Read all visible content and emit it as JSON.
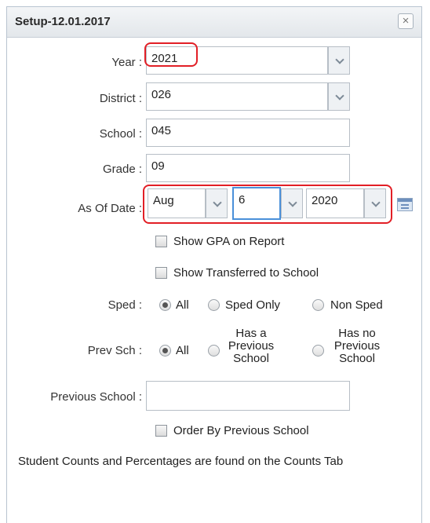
{
  "dialog": {
    "title": "Setup-12.01.2017",
    "close_label": "×"
  },
  "fields": {
    "year": {
      "label": "Year :",
      "value": "2021"
    },
    "district": {
      "label": "District :",
      "value": "026"
    },
    "school": {
      "label": "School :",
      "value": "045"
    },
    "grade": {
      "label": "Grade :",
      "value": "09"
    },
    "as_of_date": {
      "label": "As Of Date :",
      "month": "Aug",
      "day": "6",
      "year": "2020"
    }
  },
  "checkboxes": {
    "show_gpa": "Show GPA on Report",
    "show_transferred": "Show Transferred to School",
    "order_by_prev": "Order By Previous School"
  },
  "sped": {
    "label": "Sped :",
    "options": [
      "All",
      "Sped Only",
      "Non Sped"
    ],
    "selected": "All"
  },
  "prev_sch": {
    "label": "Prev Sch :",
    "all": "All",
    "has_prev": [
      "Has a",
      "Previous",
      "School"
    ],
    "has_no_prev": [
      "Has no",
      "Previous",
      "School"
    ],
    "selected": "All"
  },
  "previous_school": {
    "label": "Previous School :",
    "value": ""
  },
  "note": "Student Counts and Percentages are found on the Counts Tab",
  "colors": {
    "highlight": "#e21f26",
    "focus": "#4a90d9"
  }
}
